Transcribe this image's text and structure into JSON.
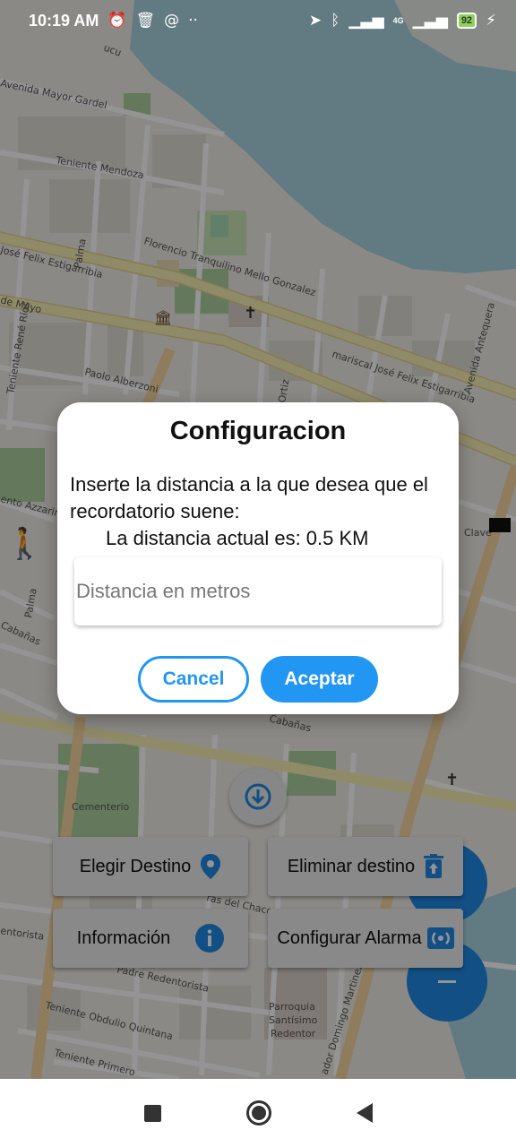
{
  "status_bar": {
    "time": "10:19 AM",
    "network": "4G",
    "battery": "92",
    "icons": [
      "alarm-off-icon",
      "trash-icon",
      "at-icon",
      "more-dots-icon",
      "location-arrow-icon",
      "bluetooth-icon",
      "signal-icon",
      "signal-4g-icon",
      "battery-icon",
      "charging-icon"
    ]
  },
  "map": {
    "streets": [
      "Avenida Mayor Gardel",
      "Teniente Mendoza",
      "Florencio Tranquilino Mello Gonzalez",
      "José Felix Estigarribia",
      "de Mayo",
      "Teniente René Ríos",
      "Paolo Alberzoni",
      "mariscal José Felix Estigarribia",
      "Avenida Antequera",
      "Palma",
      "Ortiz",
      "ento Azzarini",
      "Palma",
      "Cabañas",
      "Cementerio",
      "Cabañas",
      "ras del Chaco",
      "entorista",
      "Padre Redentorista",
      "Teniente Obdulio Quintana",
      "Teniente Primero",
      "Parroquia Santísimo Redentor",
      "ador Domingo Martinez",
      "Clave",
      "Palma",
      "ucu"
    ]
  },
  "dialog": {
    "title": "Configuracion",
    "message": "Inserte la distancia a la que desea que el recordatorio suene:",
    "current_distance": "La distancia actual es: 0.5 KM",
    "input_placeholder": "Distancia en metros",
    "input_value": "",
    "cancel_label": "Cancel",
    "accept_label": "Aceptar"
  },
  "buttons": {
    "choose_destination": "Elegir Destino",
    "delete_destination": "Eliminar destino",
    "information": "Información",
    "configure_alarm": "Configurar Alarma"
  },
  "colors": {
    "accent": "#2196f3",
    "fab": "#1e88e5"
  }
}
